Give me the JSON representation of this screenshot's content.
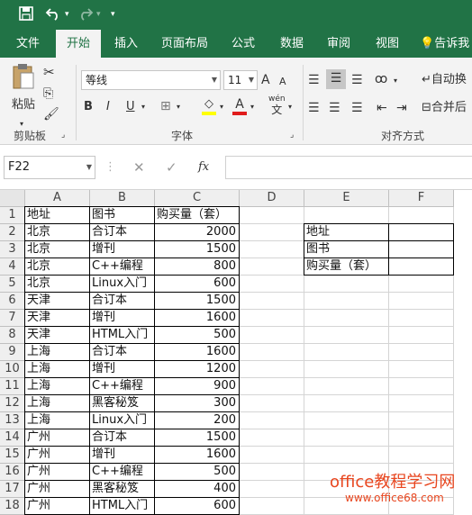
{
  "qat": {
    "save_icon": "save-icon",
    "undo_icon": "undo-icon",
    "redo_icon": "redo-icon",
    "customize_icon": "customize-qat-icon"
  },
  "tabs": [
    "文件",
    "开始",
    "插入",
    "页面布局",
    "公式",
    "数据",
    "审阅",
    "视图"
  ],
  "tell_me": "告诉我",
  "clipboard": {
    "paste": "粘贴",
    "group": "剪贴板"
  },
  "font": {
    "name": "等线",
    "size": "11",
    "bold": "B",
    "italic": "I",
    "underline": "U",
    "grow": "A",
    "shrink": "A",
    "phonetic": "wén",
    "group": "字体"
  },
  "alignment": {
    "wrap": "自动换",
    "merge": "合并后",
    "group": "对齐方式"
  },
  "formula_bar": {
    "name_box": "F22",
    "fx": "fx",
    "content": ""
  },
  "columns": [
    "A",
    "B",
    "C",
    "D",
    "E",
    "F"
  ],
  "rows": [
    {
      "n": "1",
      "a": "地址",
      "b": "图书",
      "c": "购买量（套）",
      "e": "",
      "f": ""
    },
    {
      "n": "2",
      "a": "北京",
      "b": "合订本",
      "c": "2000",
      "e": "地址",
      "f": ""
    },
    {
      "n": "3",
      "a": "北京",
      "b": "增刊",
      "c": "1500",
      "e": "图书",
      "f": ""
    },
    {
      "n": "4",
      "a": "北京",
      "b": "C++编程",
      "c": "800",
      "e": "购买量（套）",
      "f": ""
    },
    {
      "n": "5",
      "a": "北京",
      "b": "Linux入门",
      "c": "600",
      "e": "",
      "f": ""
    },
    {
      "n": "6",
      "a": "天津",
      "b": "合订本",
      "c": "1500",
      "e": "",
      "f": ""
    },
    {
      "n": "7",
      "a": "天津",
      "b": "增刊",
      "c": "1600",
      "e": "",
      "f": ""
    },
    {
      "n": "8",
      "a": "天津",
      "b": "HTML入门",
      "c": "500",
      "e": "",
      "f": ""
    },
    {
      "n": "9",
      "a": "上海",
      "b": "合订本",
      "c": "1600",
      "e": "",
      "f": ""
    },
    {
      "n": "10",
      "a": "上海",
      "b": "增刊",
      "c": "1200",
      "e": "",
      "f": ""
    },
    {
      "n": "11",
      "a": "上海",
      "b": "C++编程",
      "c": "900",
      "e": "",
      "f": ""
    },
    {
      "n": "12",
      "a": "上海",
      "b": "黑客秘笈",
      "c": "300",
      "e": "",
      "f": ""
    },
    {
      "n": "13",
      "a": "上海",
      "b": "Linux入门",
      "c": "200",
      "e": "",
      "f": ""
    },
    {
      "n": "14",
      "a": "广州",
      "b": "合订本",
      "c": "1500",
      "e": "",
      "f": ""
    },
    {
      "n": "15",
      "a": "广州",
      "b": "增刊",
      "c": "1600",
      "e": "",
      "f": ""
    },
    {
      "n": "16",
      "a": "广州",
      "b": "C++编程",
      "c": "500",
      "e": "",
      "f": ""
    },
    {
      "n": "17",
      "a": "广州",
      "b": "黑客秘笈",
      "c": "400",
      "e": "",
      "f": ""
    },
    {
      "n": "18",
      "a": "广州",
      "b": "HTML入门",
      "c": "600",
      "e": "",
      "f": ""
    }
  ],
  "watermark": {
    "line1": "office教程学习网",
    "line2": "www.office68.com"
  },
  "colors": {
    "brand": "#217346",
    "watermark": "#e8461f"
  }
}
